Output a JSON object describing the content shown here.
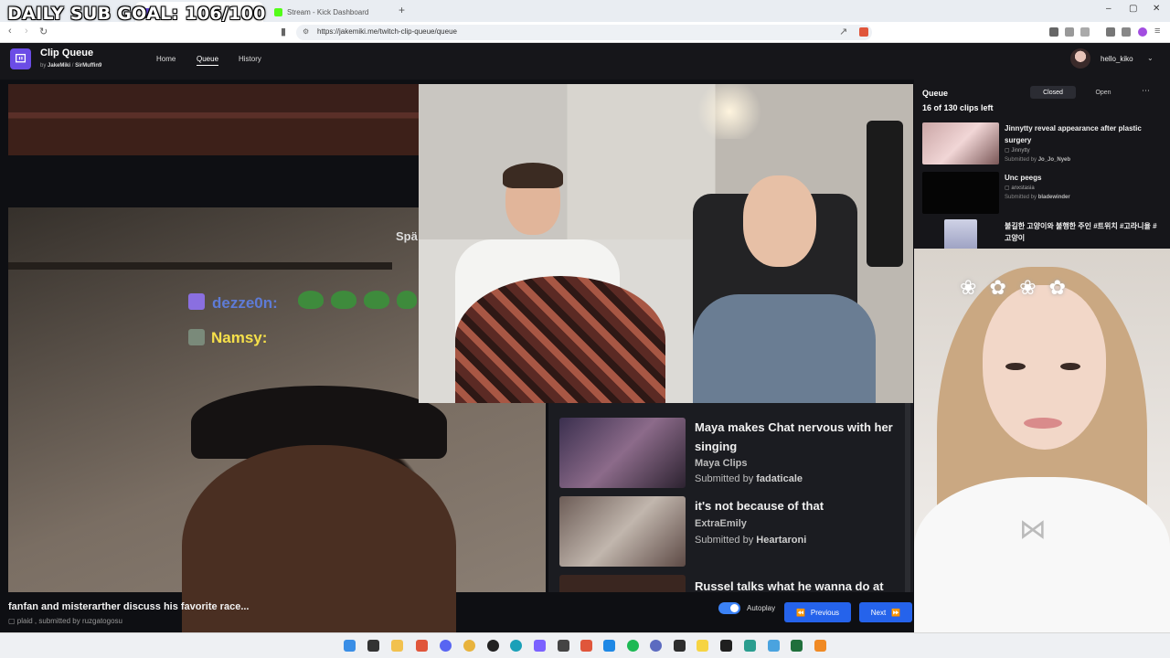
{
  "overlay": {
    "sub_goal": "DAILY SUB GOAL: 106/100"
  },
  "browser": {
    "tabs": [
      {
        "label": "",
        "active": true
      },
      {
        "label": "Stream - Kick Dashboard",
        "active": false
      }
    ],
    "url": "https://jakemiki.me/twitch-clip-queue/queue"
  },
  "app": {
    "brand": "Clip Queue",
    "by": "by",
    "author1": "JakeMiki",
    "author2": "SirMuffin9",
    "nav": [
      "Home",
      "Queue",
      "History"
    ],
    "active_nav": "Queue",
    "username": "hello_kiko"
  },
  "stream_overlay": {
    "spa_text": "Spä",
    "chat_user_1": "dezze0n:",
    "chat_user_2": "Namsy:"
  },
  "inner_queue": [
    {
      "title": "Maya makes Chat nervous with her singing",
      "channel": "Maya Clips",
      "submitted_prefix": "Submitted by",
      "submitter": "fadaticale"
    },
    {
      "title": "it's not because of that",
      "channel": "ExtraEmily",
      "submitted_prefix": "Submitted by",
      "submitter": "Heartaroni"
    },
    {
      "title": "Russel talks what he wanna do at",
      "channel": "",
      "submitted_prefix": "",
      "submitter": ""
    }
  ],
  "current_clip": {
    "title": "fanfan and misterarther discuss his favorite race...",
    "meta": "plaid , submitted by ruzgatogosu"
  },
  "controls": {
    "autoplay": "Autoplay",
    "autoplay_on": true,
    "previous": "Previous",
    "next": "Next"
  },
  "queue_panel": {
    "title": "Queue",
    "count": "16 of 130 clips left",
    "closed_label": "Closed",
    "open_label": "Open",
    "more": "⋯",
    "items": [
      {
        "title": "Jinnytty reveal appearance after plastic surgery",
        "channel": "Jinnytty",
        "submitted_prefix": "Submitted by",
        "submitter": "Jo_Jo_Nyeb"
      },
      {
        "title": "Unc peegs",
        "channel": "anxstasia",
        "submitted_prefix": "Submitted by",
        "submitter": "bladewinder"
      },
      {
        "title": "불길한 고양이와 불행한 주인 #트위치 #고라니율 #고양이",
        "channel": "",
        "submitted_prefix": "",
        "submitter": ""
      }
    ]
  },
  "colors": {
    "accent": "#2563eb",
    "brand": "#6b4ce6",
    "toggle": "#3b82f6"
  }
}
